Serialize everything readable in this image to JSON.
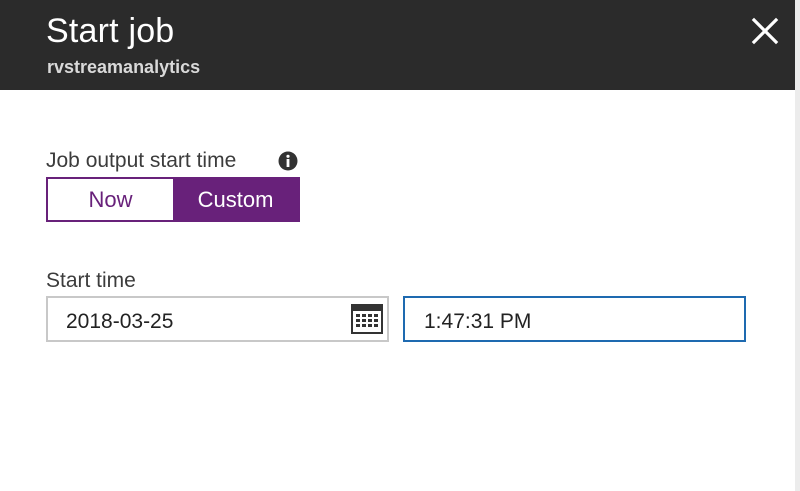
{
  "header": {
    "title": "Start job",
    "subtitle": "rvstreamanalytics",
    "close_icon": "close-icon"
  },
  "output_start": {
    "label": "Job output start time",
    "info_icon": "info-icon",
    "options": [
      "Now",
      "Custom"
    ],
    "selected": "Custom"
  },
  "start_time": {
    "label": "Start time",
    "date_value": "2018-03-25",
    "calendar_icon": "calendar-icon",
    "time_value": "1:47:31 PM"
  },
  "colors": {
    "header_bg": "#2b2b2b",
    "accent": "#68217a",
    "focus_border": "#1e6ab0"
  }
}
